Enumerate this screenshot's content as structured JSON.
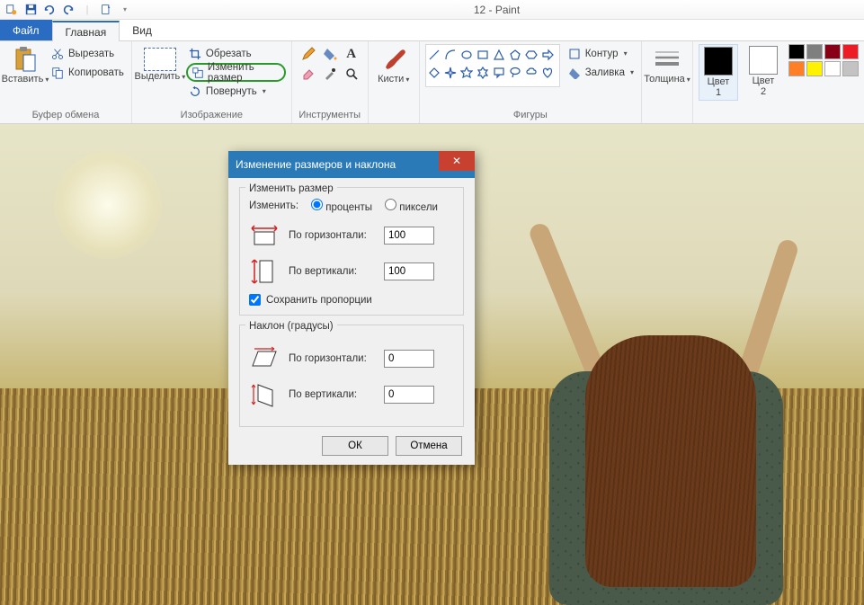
{
  "title": "12 - Paint",
  "qat": {
    "save": "save",
    "undo": "undo",
    "redo": "redo",
    "customize": "customize"
  },
  "tabs": {
    "file": "Файл",
    "home": "Главная",
    "view": "Вид"
  },
  "ribbon": {
    "clipboard": {
      "paste": "Вставить",
      "cut": "Вырезать",
      "copy": "Копировать",
      "label": "Буфер обмена"
    },
    "image": {
      "select": "Выделить",
      "crop": "Обрезать",
      "resize": "Изменить размер",
      "rotate": "Повернуть",
      "label": "Изображение"
    },
    "tools": {
      "label": "Инструменты"
    },
    "brushes": {
      "label": "Кисти"
    },
    "shapes": {
      "outline": "Контур",
      "fill": "Заливка",
      "label": "Фигуры"
    },
    "thickness": {
      "label": "Толщина"
    },
    "colors": {
      "color1": "Цвет\n1",
      "color2": "Цвет\n2",
      "palette": [
        "#000000",
        "#7f7f7f",
        "#880015",
        "#ed1c24",
        "#ff7f27",
        "#fff200",
        "#ffffff",
        "#c3c3c3"
      ]
    }
  },
  "dialog": {
    "title": "Изменение размеров и наклона",
    "resize_legend": "Изменить размер",
    "by_label": "Изменить:",
    "percent": "проценты",
    "pixels": "пиксели",
    "horizontal": "По горизонтали:",
    "vertical": "По вертикали:",
    "h_val": "100",
    "v_val": "100",
    "keep_aspect": "Сохранить пропорции",
    "skew_legend": "Наклон (градусы)",
    "skew_h_val": "0",
    "skew_v_val": "0",
    "ok": "ОК",
    "cancel": "Отмена"
  }
}
